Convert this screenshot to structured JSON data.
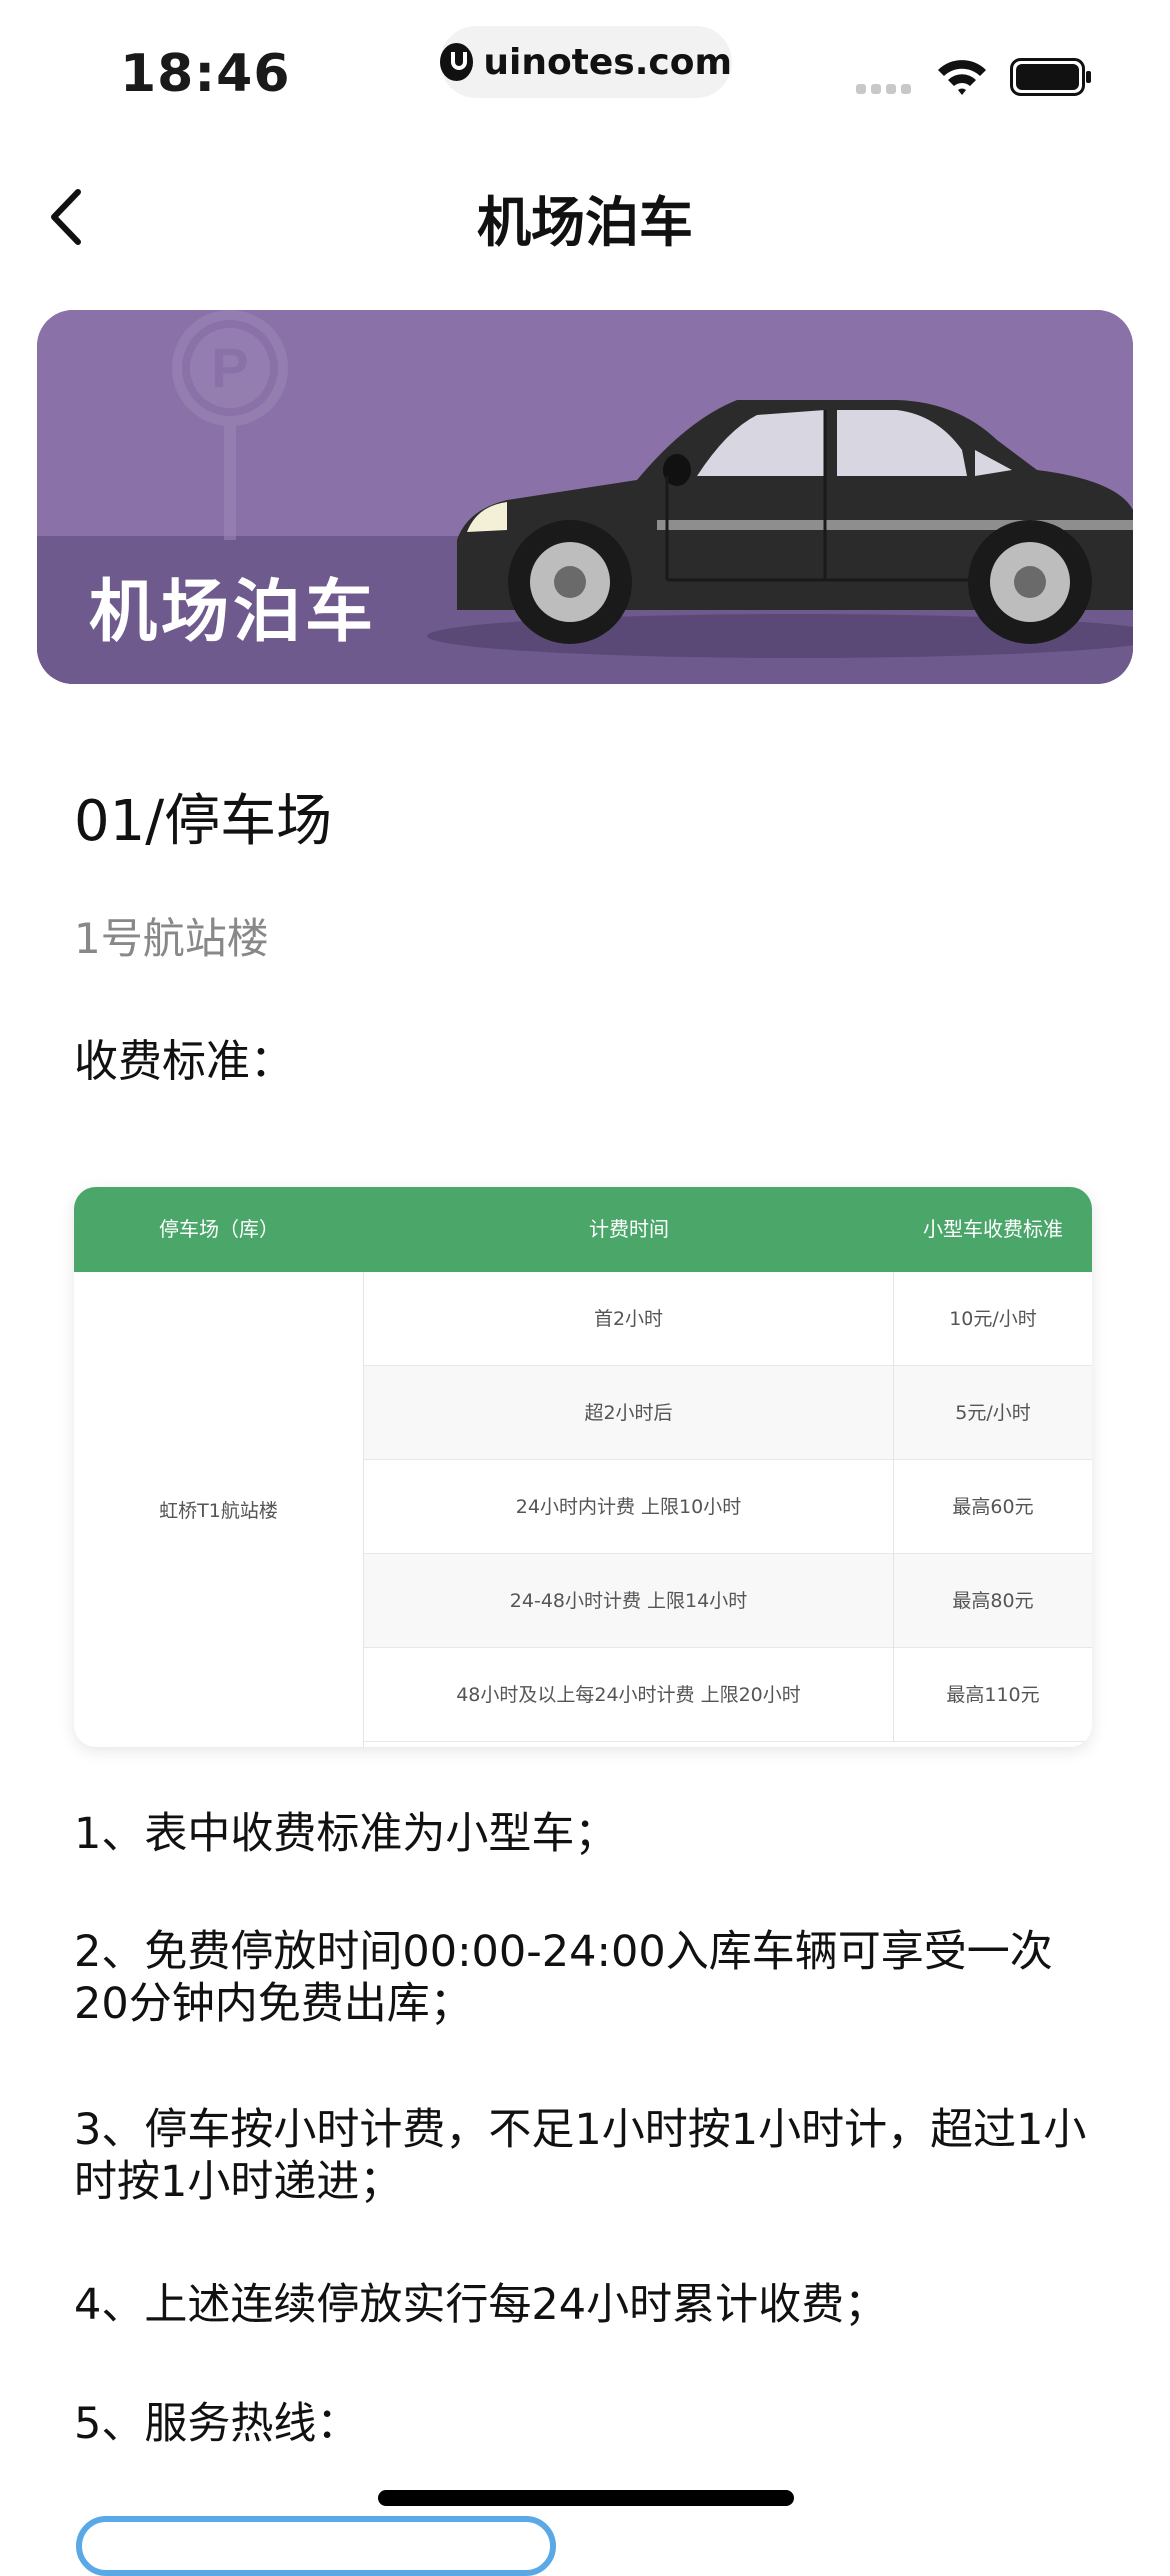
{
  "status_bar": {
    "time": "18:46",
    "url": "uinotes.com"
  },
  "nav": {
    "title": "机场泊车"
  },
  "hero": {
    "title": "机场泊车",
    "background_color": "#8a72a8"
  },
  "parking": {
    "section_title": "01/停车场",
    "terminal": "1号航站楼",
    "fee_label": "收费标准："
  },
  "fee_table": {
    "header_color": "#4ba66a",
    "headers": [
      "停车场（库）",
      "计费时间",
      "小型车收费标准"
    ],
    "lot_name": "虹桥T1航站楼",
    "rows": [
      {
        "time": "首2小时",
        "fee": "10元/小时"
      },
      {
        "time": "超2小时后",
        "fee": "5元/小时"
      },
      {
        "time": "24小时内计费 上限10小时",
        "fee": "最高60元"
      },
      {
        "time": "24-48小时计费 上限14小时",
        "fee": "最高80元"
      },
      {
        "time": "48小时及以上每24小时计费 上限20小时",
        "fee": "最高110元"
      }
    ]
  },
  "notes": [
    "1、表中收费标准为小型车；",
    "2、免费停放时间00:00-24:00入库车辆可享受一次20分钟内免费出库；",
    "3、停车按小时计费，不足1小时按1小时计，超过1小时按1小时递进；",
    "4、上述连续停放实行每24小时累计收费；",
    "5、服务热线："
  ]
}
